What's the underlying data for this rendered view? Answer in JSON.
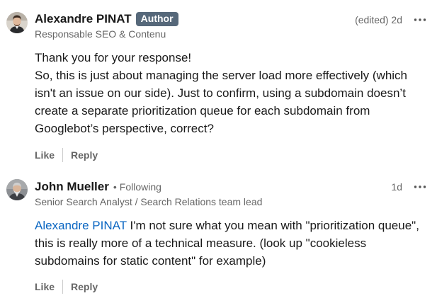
{
  "comments": [
    {
      "author": "Alexandre PINAT",
      "badge": "Author",
      "subtitle": "Responsable SEO & Contenu",
      "time": "(edited) 2d",
      "more_icon": "ellipsis-icon",
      "lines": [
        "Thank you for your response!",
        "So, this is just about managing the server load more effectively (which isn't an issue on our side). Just to confirm, using a subdomain doesn’t create a separate prioritization queue for each subdomain from Googlebot’s perspective, correct?"
      ],
      "like_label": "Like",
      "reply_label": "Reply"
    },
    {
      "author": "John Mueller",
      "following_dot": "•",
      "following": "Following",
      "subtitle": "Senior Search Analyst / Search Relations team lead",
      "time": "1d",
      "more_icon": "ellipsis-icon",
      "mention": "Alexandre PINAT",
      "text": " I'm not sure what you mean with \"prioritization queue\", this is really more of a technical measure. (look up \"cookieless subdomains for static content\" for example)",
      "like_label": "Like",
      "reply_label": "Reply"
    }
  ],
  "colors": {
    "badge_bg": "#56687a",
    "mention": "#0a66c2",
    "muted": "#666666"
  }
}
